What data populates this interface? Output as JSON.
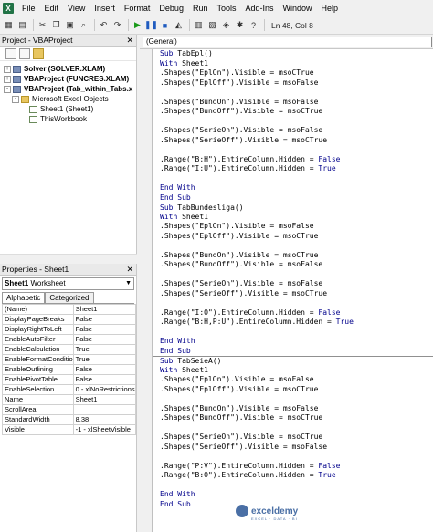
{
  "menu": [
    "File",
    "Edit",
    "View",
    "Insert",
    "Format",
    "Debug",
    "Run",
    "Tools",
    "Add-Ins",
    "Window",
    "Help"
  ],
  "toolbar": {
    "status": "Ln 48, Col 8"
  },
  "project": {
    "title": "Project - VBAProject",
    "tree": [
      {
        "label": "Solver (SOLVER.XLAM)",
        "level": 0,
        "expander": "+",
        "icon": "proj",
        "bold": true
      },
      {
        "label": "VBAProject (FUNCRES.XLAM)",
        "level": 0,
        "expander": "+",
        "icon": "proj",
        "bold": true
      },
      {
        "label": "VBAProject (Tab_within_Tabs.x",
        "level": 0,
        "expander": "-",
        "icon": "proj",
        "bold": true
      },
      {
        "label": "Microsoft Excel Objects",
        "level": 1,
        "expander": "-",
        "icon": "folder",
        "bold": false
      },
      {
        "label": "Sheet1 (Sheet1)",
        "level": 2,
        "expander": "",
        "icon": "sheet",
        "bold": false
      },
      {
        "label": "ThisWorkbook",
        "level": 2,
        "expander": "",
        "icon": "sheet",
        "bold": false
      }
    ]
  },
  "properties": {
    "title": "Properties - Sheet1",
    "object_bold": "Sheet1",
    "object_type": "Worksheet",
    "tabs": [
      "Alphabetic",
      "Categorized"
    ],
    "rows": [
      {
        "name": "(Name)",
        "value": "Sheet1"
      },
      {
        "name": "DisplayPageBreaks",
        "value": "False"
      },
      {
        "name": "DisplayRightToLeft",
        "value": "False"
      },
      {
        "name": "EnableAutoFilter",
        "value": "False"
      },
      {
        "name": "EnableCalculation",
        "value": "True"
      },
      {
        "name": "EnableFormatConditio",
        "value": "True"
      },
      {
        "name": "EnableOutlining",
        "value": "False"
      },
      {
        "name": "EnablePivotTable",
        "value": "False"
      },
      {
        "name": "EnableSelection",
        "value": "0 - xlNoRestrictions"
      },
      {
        "name": "Name",
        "value": "Sheet1"
      },
      {
        "name": "ScrollArea",
        "value": ""
      },
      {
        "name": "StandardWidth",
        "value": "8.38"
      },
      {
        "name": "Visible",
        "value": "-1 - xlSheetVisible"
      }
    ]
  },
  "code": {
    "dropdown": "(General)",
    "lines": [
      {
        "text": "Sub TabEpl()",
        "divider": false
      },
      {
        "text": "With Sheet1",
        "divider": false
      },
      {
        "text": ".Shapes(\"EplOn\").Visible = msoCTrue",
        "divider": false
      },
      {
        "text": ".Shapes(\"EplOff\").Visible = msoFalse",
        "divider": false
      },
      {
        "text": "",
        "divider": false
      },
      {
        "text": ".Shapes(\"BundOn\").Visible = msoFalse",
        "divider": false
      },
      {
        "text": ".Shapes(\"BundOff\").Visible = msoCTrue",
        "divider": false
      },
      {
        "text": "",
        "divider": false
      },
      {
        "text": ".Shapes(\"SerieOn\").Visible = msoFalse",
        "divider": false
      },
      {
        "text": ".Shapes(\"SerieOff\").Visible = msoCTrue",
        "divider": false
      },
      {
        "text": "",
        "divider": false
      },
      {
        "text": ".Range(\"B:H\").EntireColumn.Hidden = False",
        "divider": false
      },
      {
        "text": ".Range(\"I:U\").EntireColumn.Hidden = True",
        "divider": false
      },
      {
        "text": "",
        "divider": false
      },
      {
        "text": "End With",
        "divider": false
      },
      {
        "text": "End Sub",
        "divider": false
      },
      {
        "text": "Sub TabBundesliga()",
        "divider": true
      },
      {
        "text": "With Sheet1",
        "divider": false
      },
      {
        "text": ".Shapes(\"EplOn\").Visible = msoFalse",
        "divider": false
      },
      {
        "text": ".Shapes(\"EplOff\").Visible = msoCTrue",
        "divider": false
      },
      {
        "text": "",
        "divider": false
      },
      {
        "text": ".Shapes(\"BundOn\").Visible = msoCTrue",
        "divider": false
      },
      {
        "text": ".Shapes(\"BundOff\").Visible = msoFalse",
        "divider": false
      },
      {
        "text": "",
        "divider": false
      },
      {
        "text": ".Shapes(\"SerieOn\").Visible = msoFalse",
        "divider": false
      },
      {
        "text": ".Shapes(\"SerieOff\").Visible = msoCTrue",
        "divider": false
      },
      {
        "text": "",
        "divider": false
      },
      {
        "text": ".Range(\"I:O\").EntireColumn.Hidden = False",
        "divider": false
      },
      {
        "text": ".Range(\"B:H,P:U\").EntireColumn.Hidden = True",
        "divider": false
      },
      {
        "text": "",
        "divider": false
      },
      {
        "text": "End With",
        "divider": false
      },
      {
        "text": "End Sub",
        "divider": false
      },
      {
        "text": "Sub TabSeieA()",
        "divider": true
      },
      {
        "text": "With Sheet1",
        "divider": false
      },
      {
        "text": ".Shapes(\"EplOn\").Visible = msoFalse",
        "divider": false
      },
      {
        "text": ".Shapes(\"EplOff\").Visible = msoCTrue",
        "divider": false
      },
      {
        "text": "",
        "divider": false
      },
      {
        "text": ".Shapes(\"BundOn\").Visible = msoFalse",
        "divider": false
      },
      {
        "text": ".Shapes(\"BundOff\").Visible = msoCTrue",
        "divider": false
      },
      {
        "text": "",
        "divider": false
      },
      {
        "text": ".Shapes(\"SerieOn\").Visible = msoCTrue",
        "divider": false
      },
      {
        "text": ".Shapes(\"SerieOff\").Visible = msoFalse",
        "divider": false
      },
      {
        "text": "",
        "divider": false
      },
      {
        "text": ".Range(\"P:V\").EntireColumn.Hidden = False",
        "divider": false
      },
      {
        "text": ".Range(\"B:O\").EntireColumn.Hidden = True",
        "divider": false
      },
      {
        "text": "",
        "divider": false
      },
      {
        "text": "End With",
        "divider": false
      },
      {
        "text": "End Sub",
        "divider": false
      }
    ]
  },
  "watermark": {
    "name": "exceldemy",
    "tagline": "EXCEL · DATA · BI"
  },
  "colors": {
    "keyword": "#00008b",
    "background": "#f0f0f0"
  }
}
